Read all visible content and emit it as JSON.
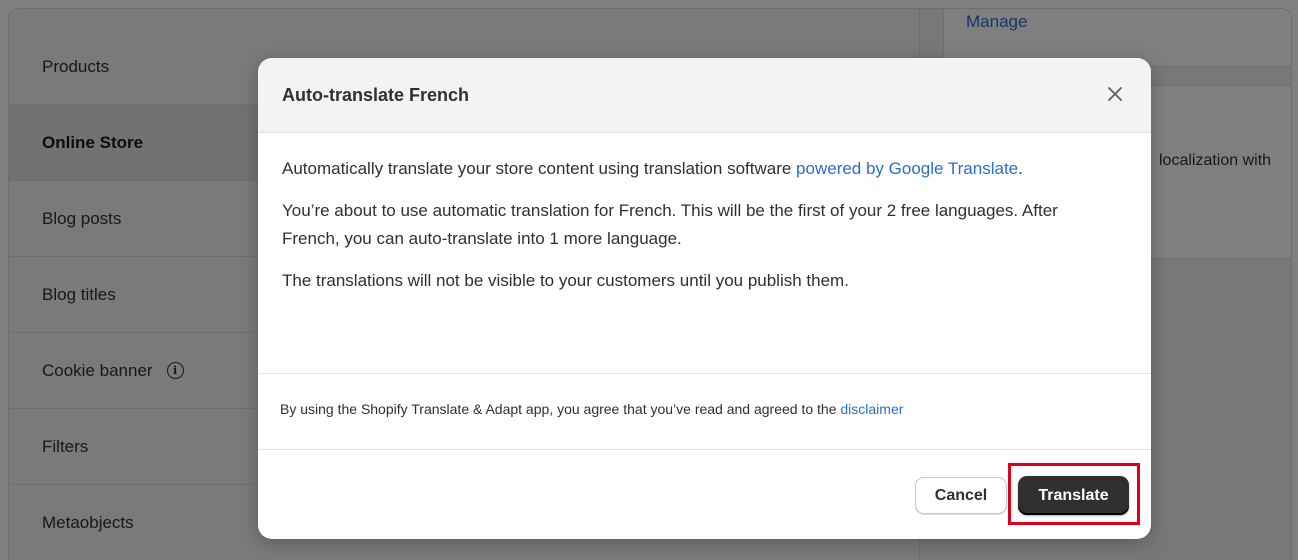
{
  "sidebar": {
    "items": [
      {
        "label": "Products"
      },
      {
        "label": "Online Store"
      },
      {
        "label": "Blog posts"
      },
      {
        "label": "Blog titles"
      },
      {
        "label": "Cookie banner"
      },
      {
        "label": "Filters"
      },
      {
        "label": "Metaobjects"
      }
    ],
    "active_item": "Online Store"
  },
  "right_panel": {
    "manage_link": "Manage",
    "localization_text": "localization with"
  },
  "modal": {
    "title": "Auto-translate French",
    "close_icon": "close-icon",
    "body": {
      "p1_text": "Automatically translate your store content using translation software ",
      "p1_link": "powered by Google Translate",
      "p1_end": ".",
      "p2": "You’re about to use automatic translation for French. This will be the first of your 2 free languages. After French, you can auto-translate into 1 more language.",
      "p3": "The translations will not be visible to your customers until you publish them."
    },
    "disclaimer": {
      "text": "By using the Shopify Translate & Adapt app, you agree that you’ve read and agreed to the ",
      "link": "disclaimer"
    },
    "buttons": {
      "cancel": "Cancel",
      "translate": "Translate"
    }
  },
  "colors": {
    "link": "#2c6ecb",
    "primary_button": "#303030",
    "highlight": "#e0001b"
  }
}
